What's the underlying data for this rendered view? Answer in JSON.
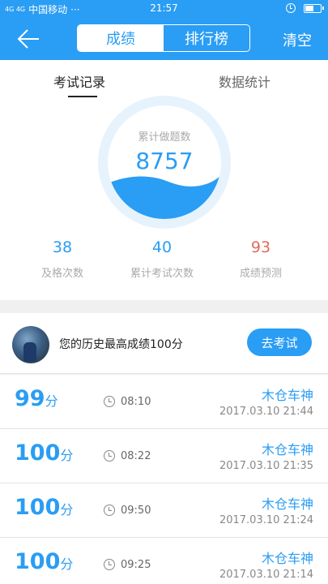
{
  "status_bar": {
    "signal": "4G 4G",
    "carrier": "中国移动",
    "dots": "···",
    "time": "21:57",
    "battery_level": 0.6
  },
  "nav": {
    "back_icon": "arrow-left-icon",
    "tabs": [
      "成绩",
      "排行榜"
    ],
    "active_tab": 0,
    "clear_label": "清空"
  },
  "subtabs": [
    "考试记录",
    "数据统计"
  ],
  "gauge": {
    "label": "累计做题数",
    "value": "8757"
  },
  "stats": [
    {
      "value": "38",
      "label": "及格次数",
      "color": "#2a9df4"
    },
    {
      "value": "40",
      "label": "累计考试次数",
      "color": "#2a9df4"
    },
    {
      "value": "93",
      "label": "成绩预测",
      "color": "#e06b5c"
    }
  ],
  "best": {
    "text": "您的历史最高成绩100分",
    "button_label": "去考试"
  },
  "records": [
    {
      "score": "99",
      "unit": "分",
      "duration": "08:10",
      "user": "木仓车神",
      "date": "2017.03.10  21:44"
    },
    {
      "score": "100",
      "unit": "分",
      "duration": "08:22",
      "user": "木仓车神",
      "date": "2017.03.10  21:35"
    },
    {
      "score": "100",
      "unit": "分",
      "duration": "09:50",
      "user": "木仓车神",
      "date": "2017.03.10  21:24"
    },
    {
      "score": "100",
      "unit": "分",
      "duration": "09:25",
      "user": "木仓车神",
      "date": "2017.03.10  21:14"
    }
  ],
  "colors": {
    "accent": "#2a9df4",
    "prediction": "#e06b5c"
  }
}
